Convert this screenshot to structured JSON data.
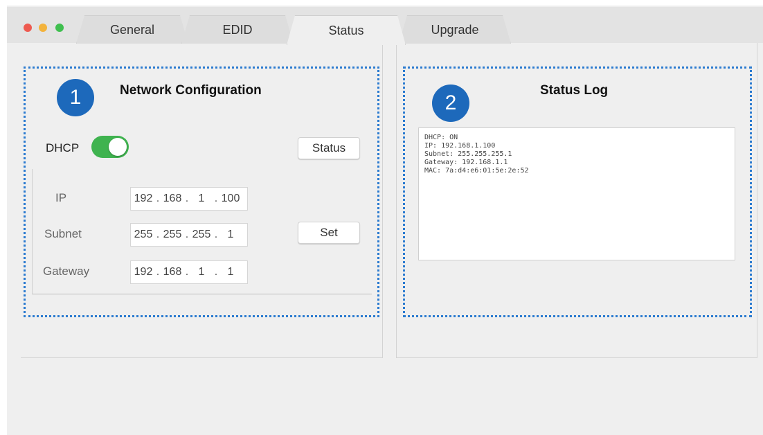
{
  "window": {
    "tabs": [
      {
        "label": "General"
      },
      {
        "label": "EDID"
      },
      {
        "label": "Status",
        "active": true
      },
      {
        "label": "Upgrade"
      }
    ]
  },
  "network": {
    "badge": "1",
    "title": "Network Configuration",
    "dhcp_label": "DHCP",
    "dhcp_on": true,
    "status_button": "Status",
    "set_button": "Set",
    "ip_label": "IP",
    "subnet_label": "Subnet",
    "gateway_label": "Gateway",
    "ip": [
      "192",
      "168",
      "1",
      "100"
    ],
    "subnet": [
      "255",
      "255",
      "255",
      "1"
    ],
    "gateway": [
      "192",
      "168",
      "1",
      "1"
    ]
  },
  "status_log": {
    "badge": "2",
    "title": "Status Log",
    "lines": [
      "DHCP: ON",
      "IP: 192.168.1.100",
      "Subnet: 255.255.255.1",
      "Gateway: 192.168.1.1",
      "MAC: 7a:d4:e6:01:5e:2e:52"
    ]
  },
  "colors": {
    "accent": "#1d69bb",
    "toggle_on": "#3fb34f",
    "dashed_border": "#2b7bd0"
  }
}
